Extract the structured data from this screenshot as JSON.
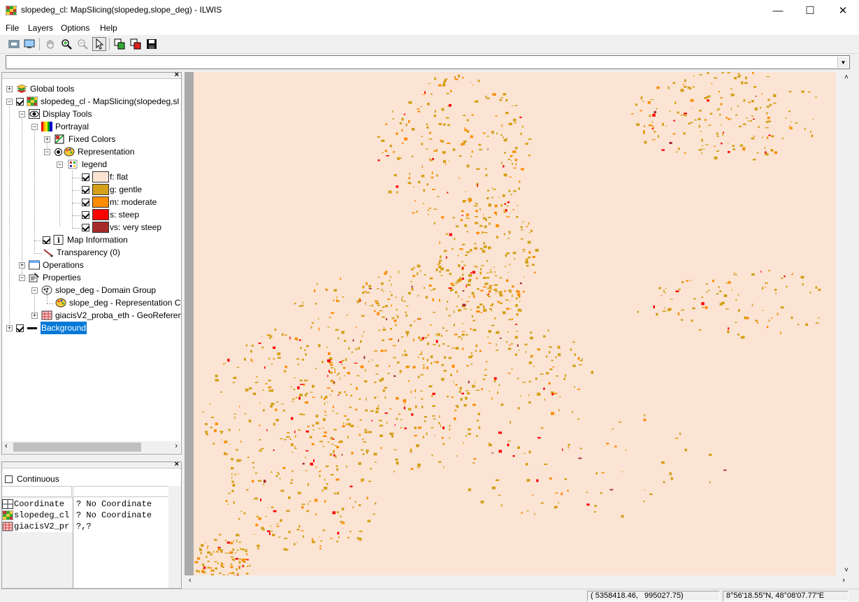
{
  "window": {
    "title": "slopedeg_cl: MapSlicing(slopedeg,slope_deg) - ILWIS",
    "minimize_glyph": "—",
    "maximize_glyph": "☐",
    "close_glyph": "✕"
  },
  "menu": {
    "items": [
      {
        "label": "File"
      },
      {
        "label": "Layers"
      },
      {
        "label": "Options"
      },
      {
        "label": "Help"
      }
    ]
  },
  "toolbar": {
    "buttons": [
      "entire-map-icon",
      "redraw-icon",
      "pan-hand-icon",
      "zoom-in-icon",
      "zoom-out-icon",
      "select-pointer-icon",
      "copy-icon",
      "print-icon",
      "save-icon"
    ]
  },
  "command_line": {
    "value": ""
  },
  "layer_tree": {
    "global_tools": "Global tools",
    "map_layer": "slopedeg_cl - MapSlicing(slopedeg,sl",
    "display_tools": "Display Tools",
    "portrayal": "Portrayal",
    "fixed_colors": "Fixed Colors",
    "representation": "Representation",
    "legend": "legend",
    "legend_items": [
      {
        "label": "f: flat",
        "color": "#fbe4d4"
      },
      {
        "label": "g: gentle",
        "color": "#d4a017"
      },
      {
        "label": "m: moderate",
        "color": "#ff8c00"
      },
      {
        "label": "s: steep",
        "color": "#ff0000"
      },
      {
        "label": "vs: very steep",
        "color": "#a52a2a"
      }
    ],
    "map_information": "Map Information",
    "transparency": "Transparency (0)",
    "operations": "Operations",
    "properties": "Properties",
    "domain_group": "slope_deg - Domain Group",
    "representation_class": "slope_deg - Representation Cl",
    "georeference": "giacisV2_proba_eth - GeoReferen",
    "background": "Background"
  },
  "info_panel": {
    "continuous_label": "Continuous",
    "rows": [
      {
        "name": "Coordinate",
        "value": "? No Coordinate"
      },
      {
        "name": "slopedeg_cl",
        "value": "? No Coordinate"
      },
      {
        "name": "giacisV2_pr",
        "value": "?,?"
      }
    ]
  },
  "status": {
    "coordinates": "( 5358418.46,   995027.75)",
    "latlon": "8°56'18.55\"N, 48°08'07.77\"E"
  },
  "colors": {
    "flat": "#fbe4d4",
    "gentle": "#d4a017",
    "moderate": "#ff8c00",
    "steep": "#ff0000",
    "very_steep": "#a52a2a",
    "selection": "#0078d7"
  }
}
